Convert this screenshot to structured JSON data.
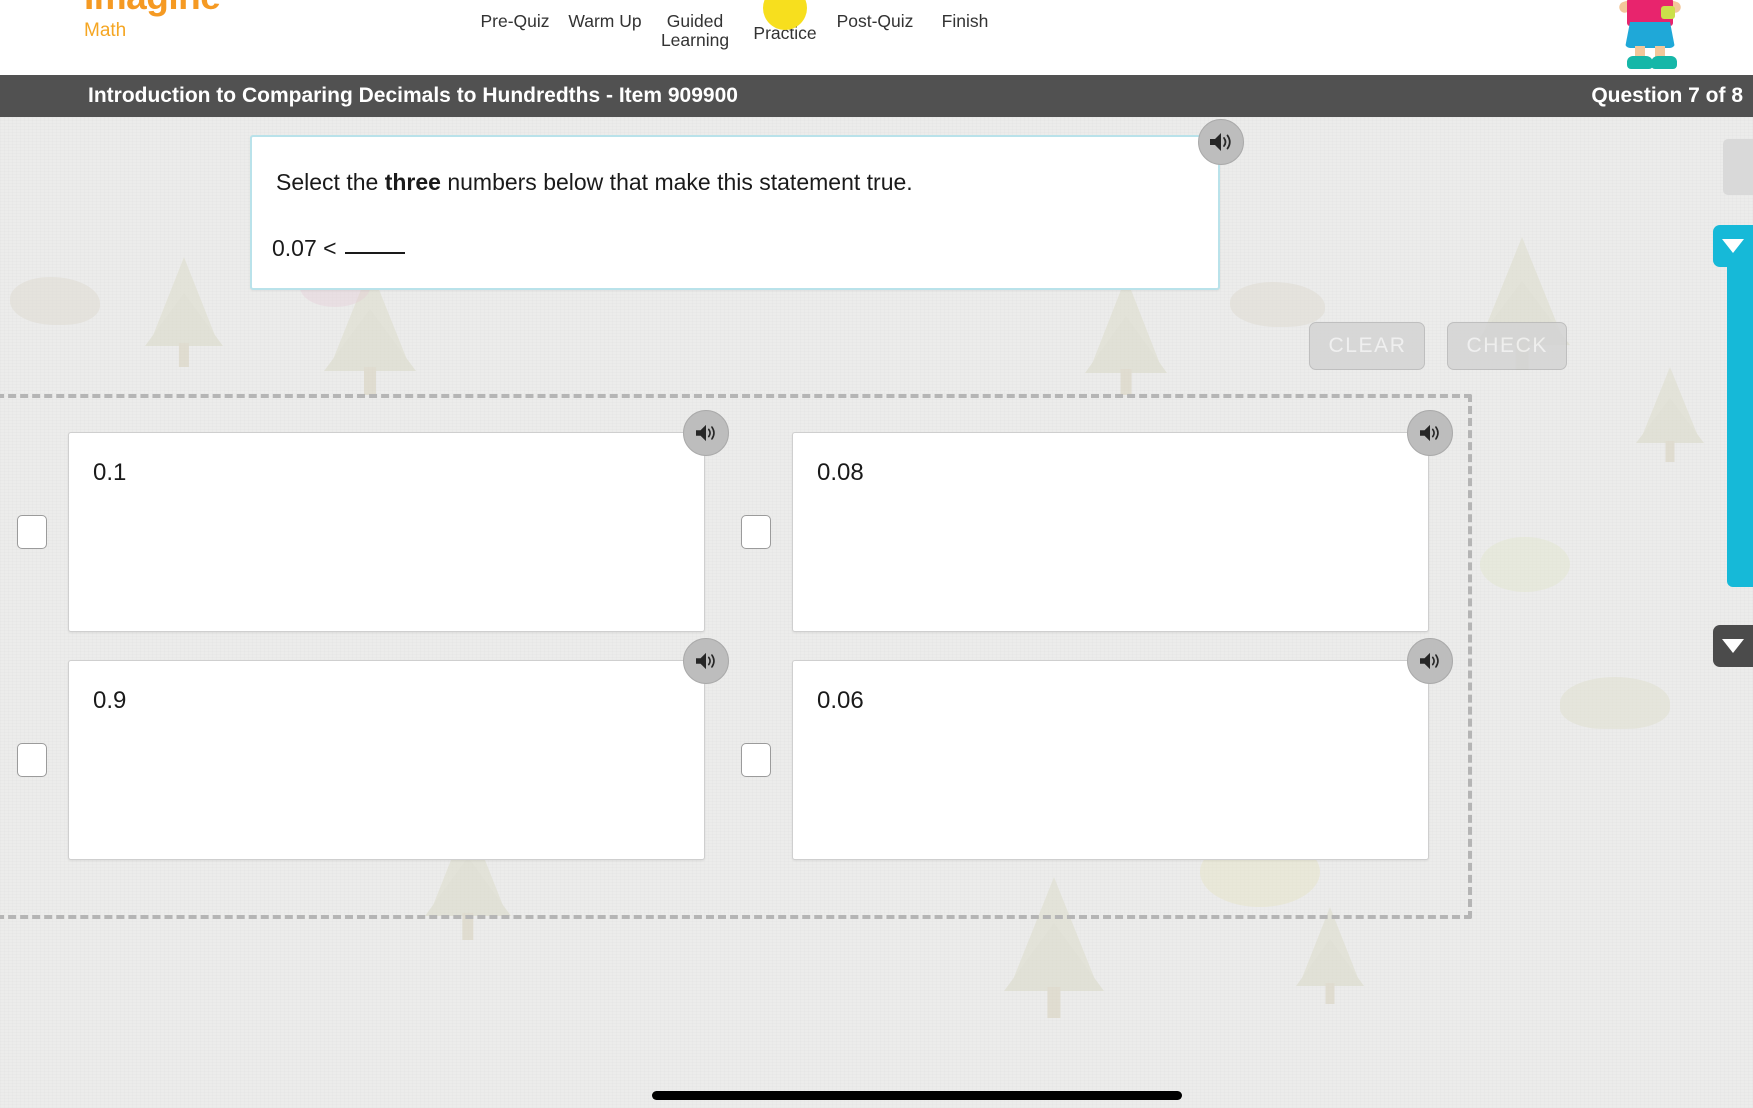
{
  "brand": {
    "name_top": "Imagine",
    "name_bottom": "Math"
  },
  "nav": {
    "items": [
      {
        "label": "Pre-Quiz",
        "active": false
      },
      {
        "label": "Warm Up",
        "active": false
      },
      {
        "label": "Guided\nLearning",
        "active": false
      },
      {
        "label": "Practice",
        "active": true
      },
      {
        "label": "Post-Quiz",
        "active": false
      },
      {
        "label": "Finish",
        "active": false
      }
    ]
  },
  "titlebar": {
    "lesson_title": "Introduction to Comparing Decimals to Hundredths - Item 909900",
    "question_counter": "Question 7 of 8"
  },
  "question": {
    "prompt_before": "Select the ",
    "prompt_bold": "three",
    "prompt_after": " numbers below that make this statement true.",
    "statement_prefix": "0.07 <",
    "statement_blank": "",
    "speaker_icon": "speaker-icon"
  },
  "toolbar": {
    "clear_label": "CLEAR",
    "check_label": "CHECK"
  },
  "choices": [
    {
      "value": "0.1",
      "checked": false,
      "speaker_icon": "speaker-icon"
    },
    {
      "value": "0.08",
      "checked": false,
      "speaker_icon": "speaker-icon"
    },
    {
      "value": "0.9",
      "checked": false,
      "speaker_icon": "speaker-icon"
    },
    {
      "value": "0.06",
      "checked": false,
      "speaker_icon": "speaker-icon"
    }
  ],
  "right_rail": {
    "cyan_tab_icon": "chevron-down-icon",
    "dark_tab_icon": "chevron-down-icon"
  },
  "colors": {
    "brand_orange": "#f5a623",
    "titlebar_gray": "#515151",
    "accent_cyan": "#16b9d8",
    "active_step_yellow": "#f7df1e",
    "question_border": "#b9e2ea"
  }
}
